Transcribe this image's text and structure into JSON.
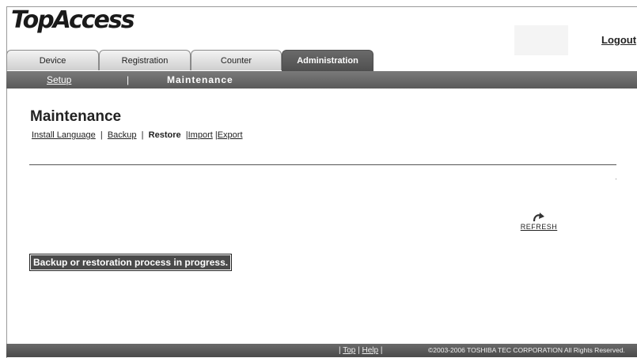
{
  "brand": {
    "logo": "TopAccess"
  },
  "header": {
    "logout_label": "Logout"
  },
  "tabs": [
    {
      "label": "Device"
    },
    {
      "label": "Registration"
    },
    {
      "label": "Counter"
    },
    {
      "label": "Administration",
      "active": true
    }
  ],
  "subnav": {
    "setup_label": "Setup",
    "separator": "|",
    "maintenance_label": "Maintenance"
  },
  "page": {
    "title": "Maintenance",
    "links": {
      "install_language": "Install Language",
      "backup": "Backup",
      "restore": "Restore",
      "import": "Import",
      "export": "Export",
      "separator": "|"
    },
    "refresh_label": "REFRESH",
    "refresh_icon": "refresh-icon",
    "status_message": "Backup or restoration process in progress."
  },
  "footer": {
    "links": {
      "top": "Top",
      "help": "Help",
      "separator": "|"
    },
    "copyright": "©2003-2006 TOSHIBA TEC CORPORATION All Rights Reserved."
  },
  "colors": {
    "nav_bar": "#5f5f5f",
    "active_tab": "#555555",
    "status_bg": "#4a4a4a"
  }
}
